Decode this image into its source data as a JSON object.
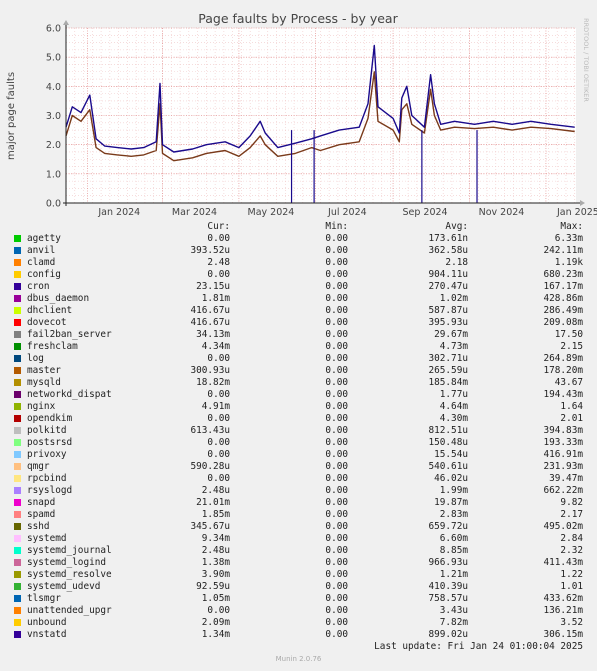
{
  "chart_data": {
    "type": "line",
    "title": "Page faults by Process - by year",
    "ylabel": "major page faults",
    "xlabel": "",
    "ylim": [
      0,
      6
    ],
    "yticks": [
      "0.0",
      "1.0",
      "2.0",
      "3.0",
      "4.0",
      "5.0",
      "6.0"
    ],
    "x_range": [
      "2023-12-15",
      "2025-01-25"
    ],
    "xticks": [
      {
        "label": "Jan 2024",
        "date": "2024-01-01"
      },
      {
        "label": "Mar 2024",
        "date": "2024-03-01"
      },
      {
        "label": "May 2024",
        "date": "2024-05-01"
      },
      {
        "label": "Jul 2024",
        "date": "2024-07-01"
      },
      {
        "label": "Sep 2024",
        "date": "2024-09-01"
      },
      {
        "label": "Nov 2024",
        "date": "2024-11-01"
      },
      {
        "label": "Jan 2025",
        "date": "2025-01-01"
      }
    ],
    "grid": true,
    "legend_position": "bottom",
    "series": [
      {
        "name": "vnstatd",
        "color": "#1a0a8c",
        "points": [
          [
            "2023-12-15",
            2.6
          ],
          [
            "2023-12-20",
            3.3
          ],
          [
            "2023-12-27",
            3.1
          ],
          [
            "2024-01-03",
            3.7
          ],
          [
            "2024-01-08",
            2.2
          ],
          [
            "2024-01-15",
            1.95
          ],
          [
            "2024-01-25",
            1.9
          ],
          [
            "2024-02-05",
            1.85
          ],
          [
            "2024-02-15",
            1.9
          ],
          [
            "2024-02-25",
            2.1
          ],
          [
            "2024-02-28",
            4.1
          ],
          [
            "2024-03-01",
            2.0
          ],
          [
            "2024-03-10",
            1.75
          ],
          [
            "2024-03-25",
            1.85
          ],
          [
            "2024-04-05",
            2.0
          ],
          [
            "2024-04-20",
            2.1
          ],
          [
            "2024-05-01",
            1.9
          ],
          [
            "2024-05-10",
            2.3
          ],
          [
            "2024-05-18",
            2.8
          ],
          [
            "2024-05-22",
            2.4
          ],
          [
            "2024-06-01",
            1.9
          ],
          [
            "2024-06-15",
            2.05
          ],
          [
            "2024-06-28",
            2.2
          ],
          [
            "2024-07-05",
            2.3
          ],
          [
            "2024-07-20",
            2.5
          ],
          [
            "2024-08-05",
            2.6
          ],
          [
            "2024-08-12",
            3.4
          ],
          [
            "2024-08-17",
            5.4
          ],
          [
            "2024-08-20",
            3.3
          ],
          [
            "2024-09-01",
            2.9
          ],
          [
            "2024-09-06",
            2.4
          ],
          [
            "2024-09-08",
            3.6
          ],
          [
            "2024-09-12",
            4.0
          ],
          [
            "2024-09-16",
            3.0
          ],
          [
            "2024-09-26",
            2.6
          ],
          [
            "2024-10-01",
            4.4
          ],
          [
            "2024-10-04",
            3.4
          ],
          [
            "2024-10-09",
            2.7
          ],
          [
            "2024-10-20",
            2.8
          ],
          [
            "2024-11-05",
            2.7
          ],
          [
            "2024-11-20",
            2.8
          ],
          [
            "2024-12-05",
            2.7
          ],
          [
            "2024-12-20",
            2.8
          ],
          [
            "2025-01-05",
            2.7
          ],
          [
            "2025-01-24",
            2.6
          ]
        ]
      },
      {
        "name": "cron",
        "color": "#7a3a1a",
        "points": [
          [
            "2023-12-15",
            2.3
          ],
          [
            "2023-12-20",
            3.0
          ],
          [
            "2023-12-27",
            2.8
          ],
          [
            "2024-01-03",
            3.2
          ],
          [
            "2024-01-08",
            1.9
          ],
          [
            "2024-01-15",
            1.7
          ],
          [
            "2024-01-25",
            1.65
          ],
          [
            "2024-02-05",
            1.6
          ],
          [
            "2024-02-15",
            1.65
          ],
          [
            "2024-02-25",
            1.8
          ],
          [
            "2024-02-28",
            3.4
          ],
          [
            "2024-03-01",
            1.7
          ],
          [
            "2024-03-10",
            1.45
          ],
          [
            "2024-03-25",
            1.55
          ],
          [
            "2024-04-05",
            1.7
          ],
          [
            "2024-04-20",
            1.8
          ],
          [
            "2024-05-01",
            1.6
          ],
          [
            "2024-05-10",
            1.9
          ],
          [
            "2024-05-18",
            2.3
          ],
          [
            "2024-05-22",
            2.0
          ],
          [
            "2024-06-01",
            1.6
          ],
          [
            "2024-06-15",
            1.7
          ],
          [
            "2024-06-28",
            1.9
          ],
          [
            "2024-07-05",
            1.8
          ],
          [
            "2024-07-20",
            2.0
          ],
          [
            "2024-08-05",
            2.1
          ],
          [
            "2024-08-12",
            2.9
          ],
          [
            "2024-08-17",
            4.5
          ],
          [
            "2024-08-20",
            2.8
          ],
          [
            "2024-09-01",
            2.5
          ],
          [
            "2024-09-06",
            2.1
          ],
          [
            "2024-09-08",
            3.2
          ],
          [
            "2024-09-12",
            3.4
          ],
          [
            "2024-09-16",
            2.7
          ],
          [
            "2024-09-26",
            2.4
          ],
          [
            "2024-10-01",
            3.9
          ],
          [
            "2024-10-04",
            3.0
          ],
          [
            "2024-10-09",
            2.5
          ],
          [
            "2024-10-20",
            2.6
          ],
          [
            "2024-11-05",
            2.55
          ],
          [
            "2024-11-20",
            2.6
          ],
          [
            "2024-12-05",
            2.5
          ],
          [
            "2024-12-20",
            2.6
          ],
          [
            "2025-01-05",
            2.55
          ],
          [
            "2025-01-24",
            2.45
          ]
        ]
      }
    ],
    "dropouts": [
      "2024-06-12",
      "2024-06-30",
      "2024-09-24",
      "2024-11-07"
    ]
  },
  "side_text": "RRDTOOL / TOBI OETIKER",
  "legend": {
    "headers": {
      "cur": "Cur:",
      "min": "Min:",
      "avg": "Avg:",
      "max": "Max:"
    },
    "rows": [
      {
        "name": "agetty",
        "color": "#00cc00",
        "cur": "0.00",
        "min": "0.00",
        "avg": "173.61n",
        "max": "6.33m"
      },
      {
        "name": "anvil",
        "color": "#0066b3",
        "cur": "393.52u",
        "min": "0.00",
        "avg": "362.58u",
        "max": "242.11m"
      },
      {
        "name": "clamd",
        "color": "#ff8000",
        "cur": "2.48",
        "min": "0.00",
        "avg": "2.18",
        "max": "1.19k"
      },
      {
        "name": "config",
        "color": "#ffcc00",
        "cur": "0.00",
        "min": "0.00",
        "avg": "904.11u",
        "max": "680.23m"
      },
      {
        "name": "cron",
        "color": "#330099",
        "cur": "23.15u",
        "min": "0.00",
        "avg": "270.47u",
        "max": "167.17m"
      },
      {
        "name": "dbus_daemon",
        "color": "#990099",
        "cur": "1.81m",
        "min": "0.00",
        "avg": "1.02m",
        "max": "428.86m"
      },
      {
        "name": "dhclient",
        "color": "#ccff00",
        "cur": "416.67u",
        "min": "0.00",
        "avg": "587.87u",
        "max": "286.49m"
      },
      {
        "name": "dovecot",
        "color": "#ff0000",
        "cur": "416.67u",
        "min": "0.00",
        "avg": "395.93u",
        "max": "209.08m"
      },
      {
        "name": "fail2ban_server",
        "color": "#808080",
        "cur": "34.13m",
        "min": "0.00",
        "avg": "29.67m",
        "max": "17.50"
      },
      {
        "name": "freshclam",
        "color": "#008f00",
        "cur": "4.34m",
        "min": "0.00",
        "avg": "4.73m",
        "max": "2.15"
      },
      {
        "name": "log",
        "color": "#00487d",
        "cur": "0.00",
        "min": "0.00",
        "avg": "302.71u",
        "max": "264.89m"
      },
      {
        "name": "master",
        "color": "#b35a00",
        "cur": "300.93u",
        "min": "0.00",
        "avg": "265.59u",
        "max": "178.20m"
      },
      {
        "name": "mysqld",
        "color": "#b38f00",
        "cur": "18.82m",
        "min": "0.00",
        "avg": "185.84m",
        "max": "43.67"
      },
      {
        "name": "networkd_dispat",
        "color": "#6b006b",
        "cur": "0.00",
        "min": "0.00",
        "avg": "1.77u",
        "max": "194.43m"
      },
      {
        "name": "nginx",
        "color": "#8fb300",
        "cur": "4.91m",
        "min": "0.00",
        "avg": "4.64m",
        "max": "1.64"
      },
      {
        "name": "opendkim",
        "color": "#b30000",
        "cur": "0.00",
        "min": "0.00",
        "avg": "4.30m",
        "max": "2.01"
      },
      {
        "name": "polkitd",
        "color": "#bebebe",
        "cur": "613.43u",
        "min": "0.00",
        "avg": "812.51u",
        "max": "394.83m"
      },
      {
        "name": "postsrsd",
        "color": "#80ff80",
        "cur": "0.00",
        "min": "0.00",
        "avg": "150.48u",
        "max": "193.33m"
      },
      {
        "name": "privoxy",
        "color": "#80c9ff",
        "cur": "0.00",
        "min": "0.00",
        "avg": "15.54u",
        "max": "416.91m"
      },
      {
        "name": "qmgr",
        "color": "#ffc080",
        "cur": "590.28u",
        "min": "0.00",
        "avg": "540.61u",
        "max": "231.93m"
      },
      {
        "name": "rpcbind",
        "color": "#ffe680",
        "cur": "0.00",
        "min": "0.00",
        "avg": "46.02u",
        "max": "39.47m"
      },
      {
        "name": "rsyslogd",
        "color": "#aa80ff",
        "cur": "2.48u",
        "min": "0.00",
        "avg": "1.99m",
        "max": "662.22m"
      },
      {
        "name": "snapd",
        "color": "#ee00cc",
        "cur": "21.01m",
        "min": "0.00",
        "avg": "19.87m",
        "max": "9.82"
      },
      {
        "name": "spamd",
        "color": "#ff8080",
        "cur": "1.85m",
        "min": "0.00",
        "avg": "2.83m",
        "max": "2.17"
      },
      {
        "name": "sshd",
        "color": "#666600",
        "cur": "345.67u",
        "min": "0.00",
        "avg": "659.72u",
        "max": "495.02m"
      },
      {
        "name": "systemd",
        "color": "#ffbfff",
        "cur": "9.34m",
        "min": "0.00",
        "avg": "6.60m",
        "max": "2.84"
      },
      {
        "name": "systemd_journal",
        "color": "#00ffcc",
        "cur": "2.48u",
        "min": "0.00",
        "avg": "8.85m",
        "max": "2.32"
      },
      {
        "name": "systemd_logind",
        "color": "#cc6699",
        "cur": "1.38m",
        "min": "0.00",
        "avg": "966.93u",
        "max": "411.43m"
      },
      {
        "name": "systemd_resolve",
        "color": "#999900",
        "cur": "3.90m",
        "min": "0.00",
        "avg": "1.21m",
        "max": "1.22"
      },
      {
        "name": "systemd_udevd",
        "color": "#33b233",
        "cur": "92.59u",
        "min": "0.00",
        "avg": "410.39u",
        "max": "1.01"
      },
      {
        "name": "tlsmgr",
        "color": "#0066b3",
        "cur": "1.05m",
        "min": "0.00",
        "avg": "758.57u",
        "max": "433.62m"
      },
      {
        "name": "unattended_upgr",
        "color": "#ff8000",
        "cur": "0.00",
        "min": "0.00",
        "avg": "3.43u",
        "max": "136.21m"
      },
      {
        "name": "unbound",
        "color": "#ffcc00",
        "cur": "2.09m",
        "min": "0.00",
        "avg": "7.82m",
        "max": "3.52"
      },
      {
        "name": "vnstatd",
        "color": "#330099",
        "cur": "1.34m",
        "min": "0.00",
        "avg": "899.02u",
        "max": "306.15m"
      }
    ]
  },
  "last_update": "Last update: Fri Jan 24 01:00:04 2025",
  "footer": "Munin 2.0.76"
}
